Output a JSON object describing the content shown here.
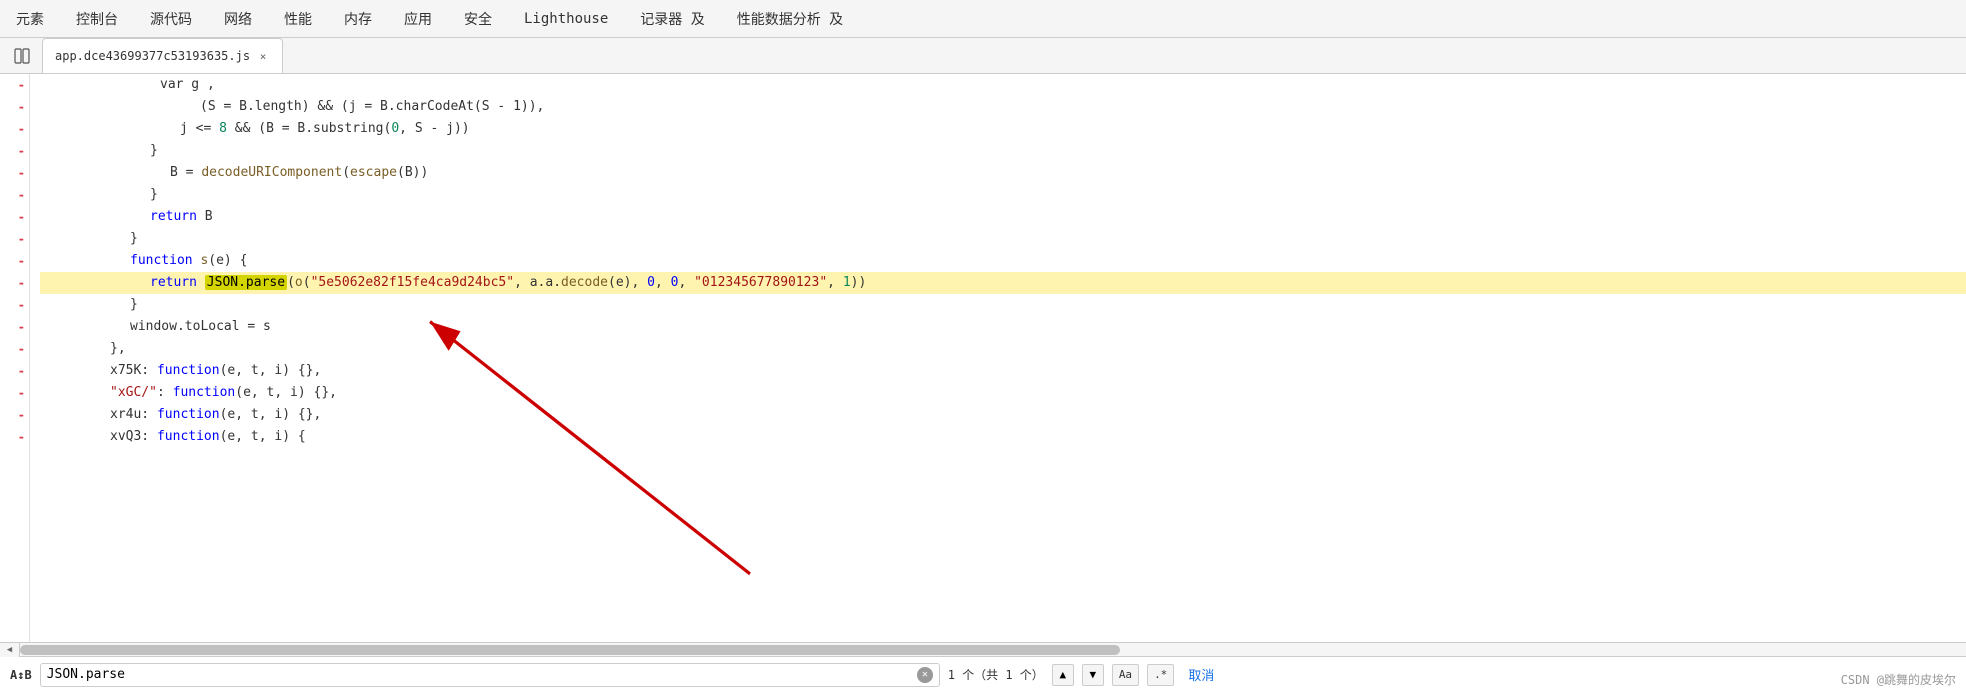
{
  "topNav": {
    "items": [
      {
        "label": "元素",
        "active": false
      },
      {
        "label": "控制台",
        "active": false
      },
      {
        "label": "源代码",
        "active": false
      },
      {
        "label": "网络",
        "active": false
      },
      {
        "label": "性能",
        "active": false
      },
      {
        "label": "内存",
        "active": false
      },
      {
        "label": "应用",
        "active": false
      },
      {
        "label": "安全",
        "active": false
      },
      {
        "label": "Lighthouse",
        "active": false
      },
      {
        "label": "记录器 及",
        "active": false
      },
      {
        "label": "性能数据分析 及",
        "active": false
      }
    ]
  },
  "tabBar": {
    "fileName": "app.dce43699377c53193635.js",
    "closeLabel": "×"
  },
  "codeLines": [
    {
      "indent": 6,
      "prefix": "",
      "content": "var g ,"
    },
    {
      "indent": 5,
      "prefix": "",
      "content": "(S = B.length) && (j = B.charCodeAt(S - 1)),"
    },
    {
      "indent": 5,
      "prefix": "",
      "content": "j <= 8 && (B = B.substring(0, S - j))"
    },
    {
      "indent": 4,
      "prefix": "",
      "content": "}"
    },
    {
      "indent": 5,
      "prefix": "",
      "content": "B = decodeURIComponent(escape(B))"
    },
    {
      "indent": 4,
      "prefix": "",
      "content": "}"
    },
    {
      "indent": 4,
      "prefix": "",
      "content": "return B"
    },
    {
      "indent": 3,
      "prefix": "",
      "content": "}"
    },
    {
      "indent": 3,
      "prefix": "",
      "content": "function s(e) {"
    },
    {
      "indent": 4,
      "prefix": "",
      "content": "return JSON.parse(o(\"5e5062e82f15fe4ca9d24bc5\", a.a.decode(e), 0, 0, \"012345677890123\", 1))"
    },
    {
      "indent": 3,
      "prefix": "",
      "content": "}"
    },
    {
      "indent": 3,
      "prefix": "",
      "content": "window.toLocal = s"
    },
    {
      "indent": 2,
      "prefix": "",
      "content": "},"
    },
    {
      "indent": 2,
      "prefix": "",
      "content": "x75K: function(e, t, i) {},"
    },
    {
      "indent": 2,
      "prefix": "",
      "content": "\"xGC/\": function(e, t, i) {},"
    },
    {
      "indent": 2,
      "prefix": "",
      "content": "xr4u: function(e, t, i) {},"
    },
    {
      "indent": 2,
      "prefix": "",
      "content": "xvQ3: function(e, t, i) {"
    }
  ],
  "searchBar": {
    "label": "A↕B",
    "inputValue": "JSON.parse",
    "resultCount": "1 个（共 1 个）",
    "upLabel": "▲",
    "downLabel": "▼",
    "optionAa": "Aa",
    "optionRegex": ".*",
    "cancelLabel": "取消"
  },
  "statusBar": {
    "watermark": "CSDN @跳舞的皮埃尔"
  }
}
